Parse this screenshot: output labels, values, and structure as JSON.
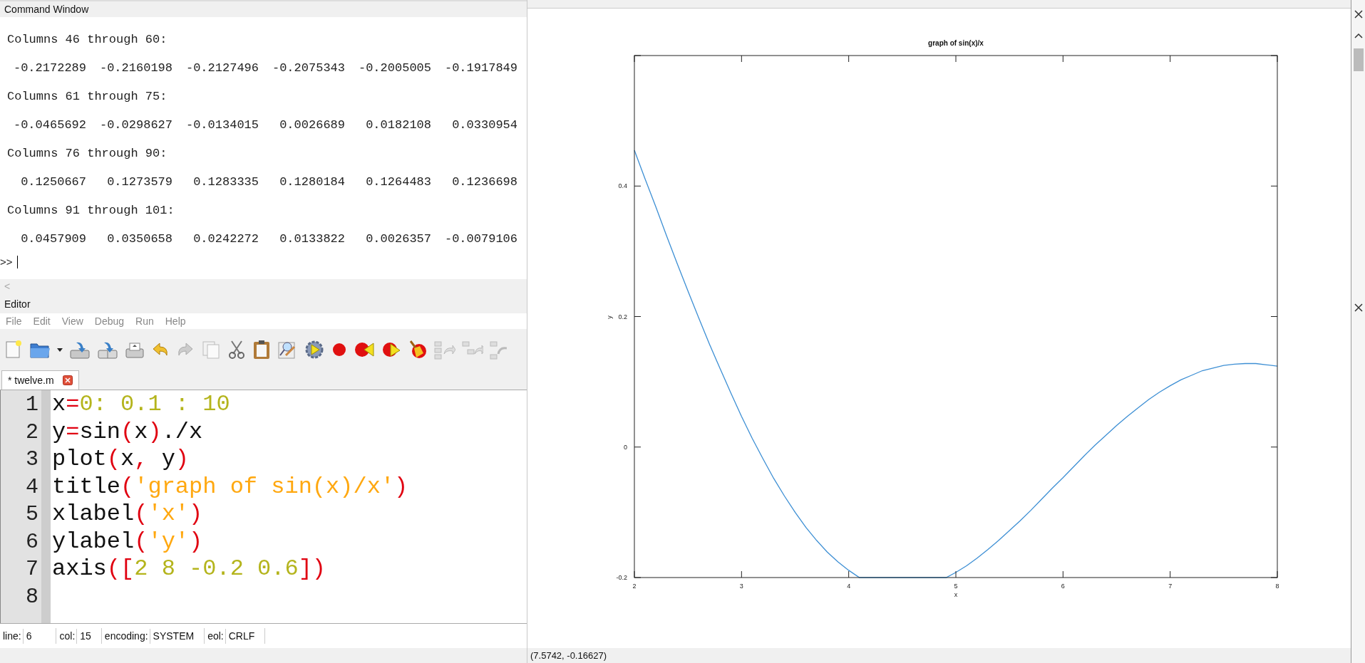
{
  "command_window": {
    "title": "Command Window",
    "blocks": [
      {
        "header": "Columns 46 through 60:",
        "values": [
          "-0.2172289",
          "-0.2160198",
          "-0.2127496",
          "-0.2075343",
          "-0.2005005",
          "-0.1917849"
        ]
      },
      {
        "header": "Columns 61 through 75:",
        "values": [
          "-0.0465692",
          "-0.0298627",
          "-0.0134015",
          "0.0026689",
          "0.0182108",
          "0.0330954"
        ]
      },
      {
        "header": "Columns 76 through 90:",
        "values": [
          "0.1250667",
          "0.1273579",
          "0.1283335",
          "0.1280184",
          "0.1264483",
          "0.1236698"
        ]
      },
      {
        "header": "Columns 91 through 101:",
        "values": [
          "0.0457909",
          "0.0350658",
          "0.0242272",
          "0.0133822",
          "0.0026357",
          "-0.0079106"
        ]
      }
    ],
    "prompt": ">>",
    "scroll_arrow": "<"
  },
  "editor": {
    "title": "Editor",
    "menu": [
      "File",
      "Edit",
      "View",
      "Debug",
      "Run",
      "Help"
    ],
    "tabs": [
      {
        "label": "* twelve.m",
        "selected": true
      }
    ],
    "lines": [
      {
        "number": "1",
        "tokens": [
          {
            "text": "x",
            "kind": "plain"
          },
          {
            "text": "=",
            "kind": "op"
          },
          {
            "text": "0: 0.1 : 10",
            "kind": "num"
          }
        ]
      },
      {
        "number": "2",
        "tokens": [
          {
            "text": "y",
            "kind": "plain"
          },
          {
            "text": "=",
            "kind": "op"
          },
          {
            "text": "sin",
            "kind": "plain"
          },
          {
            "text": "(",
            "kind": "op"
          },
          {
            "text": "x",
            "kind": "plain"
          },
          {
            "text": ")",
            "kind": "op"
          },
          {
            "text": "./x",
            "kind": "plain"
          }
        ]
      },
      {
        "number": "3",
        "tokens": [
          {
            "text": "plot",
            "kind": "plain"
          },
          {
            "text": "(",
            "kind": "op"
          },
          {
            "text": "x",
            "kind": "plain"
          },
          {
            "text": ",",
            "kind": "op"
          },
          {
            "text": " y",
            "kind": "plain"
          },
          {
            "text": ")",
            "kind": "op"
          }
        ]
      },
      {
        "number": "4",
        "tokens": [
          {
            "text": "title",
            "kind": "plain"
          },
          {
            "text": "(",
            "kind": "op"
          },
          {
            "text": "'graph of sin(x)/x'",
            "kind": "str"
          },
          {
            "text": ")",
            "kind": "op"
          }
        ]
      },
      {
        "number": "5",
        "tokens": [
          {
            "text": "xlabel",
            "kind": "plain"
          },
          {
            "text": "(",
            "kind": "op"
          },
          {
            "text": "'x'",
            "kind": "str"
          },
          {
            "text": ")",
            "kind": "op"
          }
        ]
      },
      {
        "number": "6",
        "tokens": [
          {
            "text": "ylabel",
            "kind": "plain"
          },
          {
            "text": "(",
            "kind": "op"
          },
          {
            "text": "'y'",
            "kind": "str"
          },
          {
            "text": ")",
            "kind": "op"
          }
        ]
      },
      {
        "number": "7",
        "tokens": [
          {
            "text": "axis",
            "kind": "plain"
          },
          {
            "text": "([",
            "kind": "op"
          },
          {
            "text": "2 8 -0.2 0.6",
            "kind": "num"
          },
          {
            "text": "])",
            "kind": "op"
          }
        ]
      },
      {
        "number": "8"
      }
    ],
    "status_bar": [
      {
        "label": "line:",
        "value": "6"
      },
      {
        "label": "col:",
        "value": "15"
      },
      {
        "label": "encoding:",
        "value": "SYSTEM"
      },
      {
        "label": "eol:",
        "value": "CRLF"
      }
    ]
  },
  "figure": {
    "chart_data": {
      "type": "line",
      "title": "graph of sin(x)/x",
      "xlabel": "x",
      "ylabel": "y",
      "x": [
        2.0,
        2.1,
        2.2,
        2.3,
        2.4,
        2.5,
        2.6,
        2.7,
        2.8,
        2.9,
        3.0,
        3.1,
        3.2,
        3.3,
        3.4,
        3.5,
        3.6,
        3.7,
        3.8,
        3.9,
        4.0,
        4.1,
        4.11,
        4.91,
        5.0,
        5.1,
        5.2,
        5.3,
        5.4,
        5.5,
        5.6,
        5.7,
        5.8,
        5.9,
        6.0,
        6.1,
        6.2,
        6.3,
        6.4,
        6.5,
        6.6,
        6.7,
        6.8,
        6.9,
        7.0,
        7.1,
        7.2,
        7.3,
        7.4,
        7.5,
        7.6,
        7.7,
        7.8,
        7.9,
        8.0
      ],
      "series": [
        {
          "color": "#3d8fd4",
          "values": [
            0.455,
            0.411,
            0.368,
            0.324,
            0.281,
            0.239,
            0.198,
            0.158,
            0.12,
            0.083,
            0.047,
            0.013,
            -0.018,
            -0.048,
            -0.075,
            -0.1,
            -0.123,
            -0.143,
            -0.161,
            -0.176,
            -0.189,
            -0.2,
            -0.2,
            -0.2,
            -0.192,
            -0.182,
            -0.17,
            -0.157,
            -0.143,
            -0.128,
            -0.113,
            -0.097,
            -0.08,
            -0.063,
            -0.047,
            -0.03,
            -0.013,
            0.003,
            0.018,
            0.033,
            0.047,
            0.06,
            0.073,
            0.084,
            0.094,
            0.103,
            0.11,
            0.117,
            0.121,
            0.125,
            0.127,
            0.128,
            0.128,
            0.126,
            0.124
          ]
        }
      ],
      "xlim": [
        2,
        8
      ],
      "ylim": [
        -0.2,
        0.6
      ],
      "xticks": [
        2,
        3,
        4,
        5,
        6,
        7,
        8
      ],
      "yticks": [
        -0.2,
        0,
        0.2,
        0.4
      ]
    },
    "status": "(7.5742, -0.16627)"
  }
}
